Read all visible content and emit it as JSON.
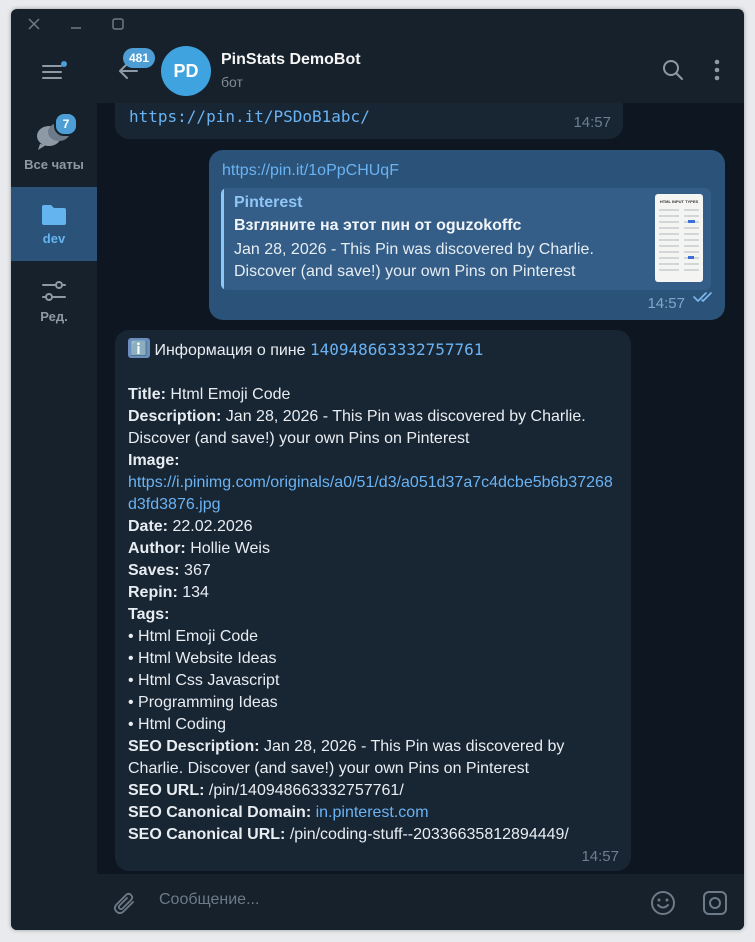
{
  "window": {
    "controls": [
      "close-icon",
      "minimize-icon",
      "maximize-icon"
    ]
  },
  "rail": {
    "items": [
      {
        "label": "Все чаты",
        "icon": "chat-bubbles-icon",
        "badge": "7"
      },
      {
        "label": "dev",
        "icon": "folder-icon",
        "active": true
      },
      {
        "label": "Ред.",
        "icon": "sliders-icon"
      }
    ]
  },
  "header": {
    "back_badge": "481",
    "avatar_initials": "PD",
    "title": "PinStats DemoBot",
    "subtitle": "бот"
  },
  "messages": {
    "prev_link": "https://pin.it/PSDoB1abc/",
    "prev_time": "14:57",
    "out_link": "https://pin.it/1oPpCHUqF",
    "out_time": "14:57",
    "preview": {
      "site": "Pinterest",
      "title": "Взгляните на этот пин от oguzokoffc",
      "description": "Jan 28, 2026 - This Pin was discovered by Charlie. Discover (and save!) your own Pins on Pinterest",
      "thumb_title": "HTML INPUT TYPES"
    },
    "info": {
      "emoji": "ℹ️",
      "heading": "Информация о пине",
      "pin_id": "140948663332757761",
      "title_label": "Title:",
      "title_value": "Html Emoji Code",
      "desc_label": "Description:",
      "desc_value": "Jan 28, 2026 - This Pin was discovered by Charlie. Discover (and save!) your own Pins on Pinterest",
      "image_label": "Image:",
      "image_url": "https://i.pinimg.com/originals/a0/51/d3/a051d37a7c4dcbe5b6b37268d3fd3876.jpg",
      "date_label": "Date:",
      "date_value": "22.02.2026",
      "author_label": "Author:",
      "author_value": "Hollie Weis",
      "saves_label": "Saves:",
      "saves_value": "367",
      "repin_label": "Repin:",
      "repin_value": "134",
      "tags_label": "Tags:",
      "tags": [
        "• Html Emoji Code",
        "• Html Website Ideas",
        "• Html Css Javascript",
        "• Programming Ideas",
        "• Html Coding"
      ],
      "seo_desc_label": "SEO Description:",
      "seo_desc_value": "Jan 28, 2026 - This Pin was discovered by Charlie. Discover (and save!) your own Pins on Pinterest",
      "seo_url_label": "SEO URL:",
      "seo_url_value": "/pin/140948663332757761/",
      "seo_domain_label": "SEO Canonical Domain:",
      "seo_domain_value": "in.pinterest.com",
      "seo_canon_label": "SEO Canonical URL:",
      "seo_canon_value": "/pin/coding-stuff--20336635812894449/",
      "time": "14:57"
    }
  },
  "composer": {
    "placeholder": "Сообщение..."
  },
  "colors": {
    "accent": "#4e9ed6",
    "outgoing": "#2b5278",
    "incoming": "#182533",
    "background": "#0e1621",
    "link": "#6ab3f3"
  }
}
